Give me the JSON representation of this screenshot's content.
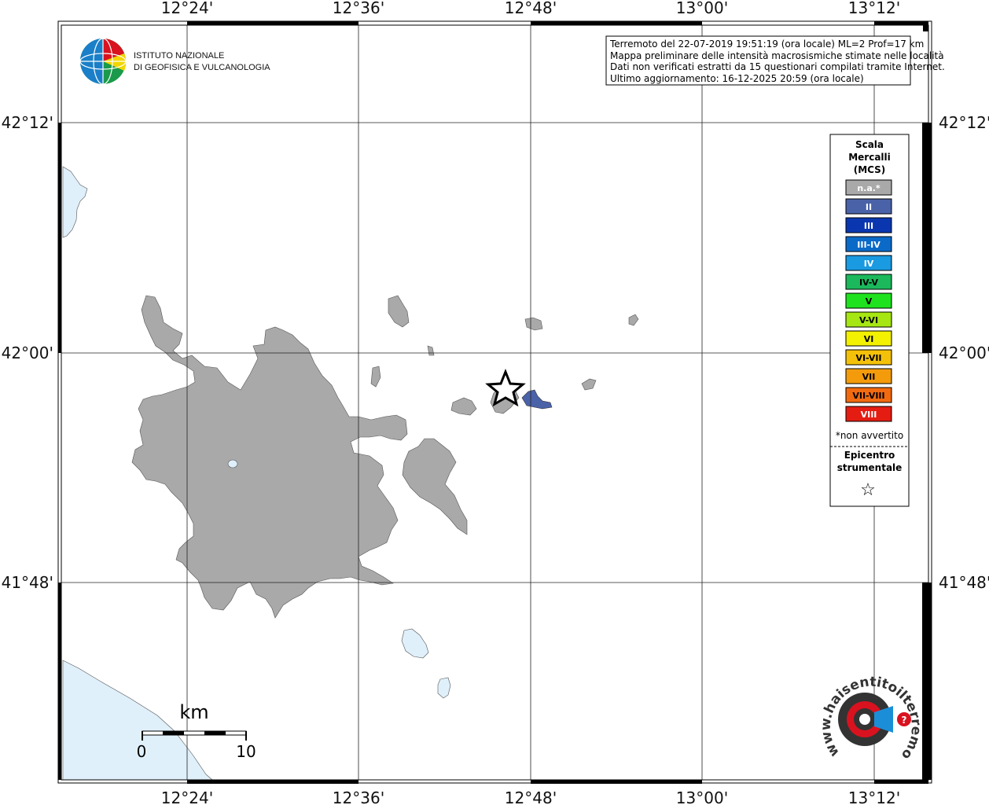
{
  "map": {
    "lon_ticks": [
      "12°24'",
      "12°36'",
      "12°48'",
      "13°00'",
      "13°12'"
    ],
    "lat_ticks": [
      "42°12'",
      "42°00'",
      "41°48'"
    ],
    "colors": {
      "land_builtup": "#a9a9a9",
      "water": "#dff0fb",
      "grid": "#222222",
      "intensity_II": "#4a62a8"
    }
  },
  "logo": {
    "line1": "ISTITUTO NAZIONALE",
    "line2": "DI GEOFISICA E VULCANOLOGIA"
  },
  "info_box": {
    "line1": "Terremoto del 22-07-2019 19:51:19 (ora locale) ML=2 Prof=17 km",
    "line2": "Mappa preliminare delle intensità macrosismiche stimate nelle località",
    "line3": "Dati non verificati estratti da 15 questionari compilati tramite Internet.",
    "line4": "Ultimo aggiornamento: 16-12-2025 20:59 (ora locale)"
  },
  "legend": {
    "title1": "Scala",
    "title2": "Mercalli",
    "title3": "(MCS)",
    "items": [
      {
        "label": "n.a.*",
        "color": "#a9a9a9",
        "text_color": "#ffffff"
      },
      {
        "label": "II",
        "color": "#4a62a8",
        "text_color": "#ffffff"
      },
      {
        "label": "III",
        "color": "#0a37b0",
        "text_color": "#ffffff"
      },
      {
        "label": "III-IV",
        "color": "#0b6ac8",
        "text_color": "#ffffff"
      },
      {
        "label": "IV",
        "color": "#1a9ae0",
        "text_color": "#ffffff"
      },
      {
        "label": "IV-V",
        "color": "#1bb85c",
        "text_color": "#000000"
      },
      {
        "label": "V",
        "color": "#1ee21e",
        "text_color": "#000000"
      },
      {
        "label": "V-VI",
        "color": "#a6e612",
        "text_color": "#000000"
      },
      {
        "label": "VI",
        "color": "#f3f000",
        "text_color": "#000000"
      },
      {
        "label": "VI-VII",
        "color": "#f4c10a",
        "text_color": "#000000"
      },
      {
        "label": "VII",
        "color": "#f49b0c",
        "text_color": "#000000"
      },
      {
        "label": "VII-VIII",
        "color": "#f26a10",
        "text_color": "#000000"
      },
      {
        "label": "VIII",
        "color": "#e41c12",
        "text_color": "#ffffff"
      }
    ],
    "note": "*non avvertito",
    "epi1": "Epicentro",
    "epi2": "strumentale",
    "epi_symbol": "☆"
  },
  "scalebar": {
    "unit": "km",
    "label_start": "0",
    "label_end": "10"
  },
  "site_logo": {
    "text": "www.haisentitoilterremoto.it",
    "colors": {
      "red": "#d9121f",
      "blue": "#1a8fd8",
      "dark": "#333333"
    }
  }
}
